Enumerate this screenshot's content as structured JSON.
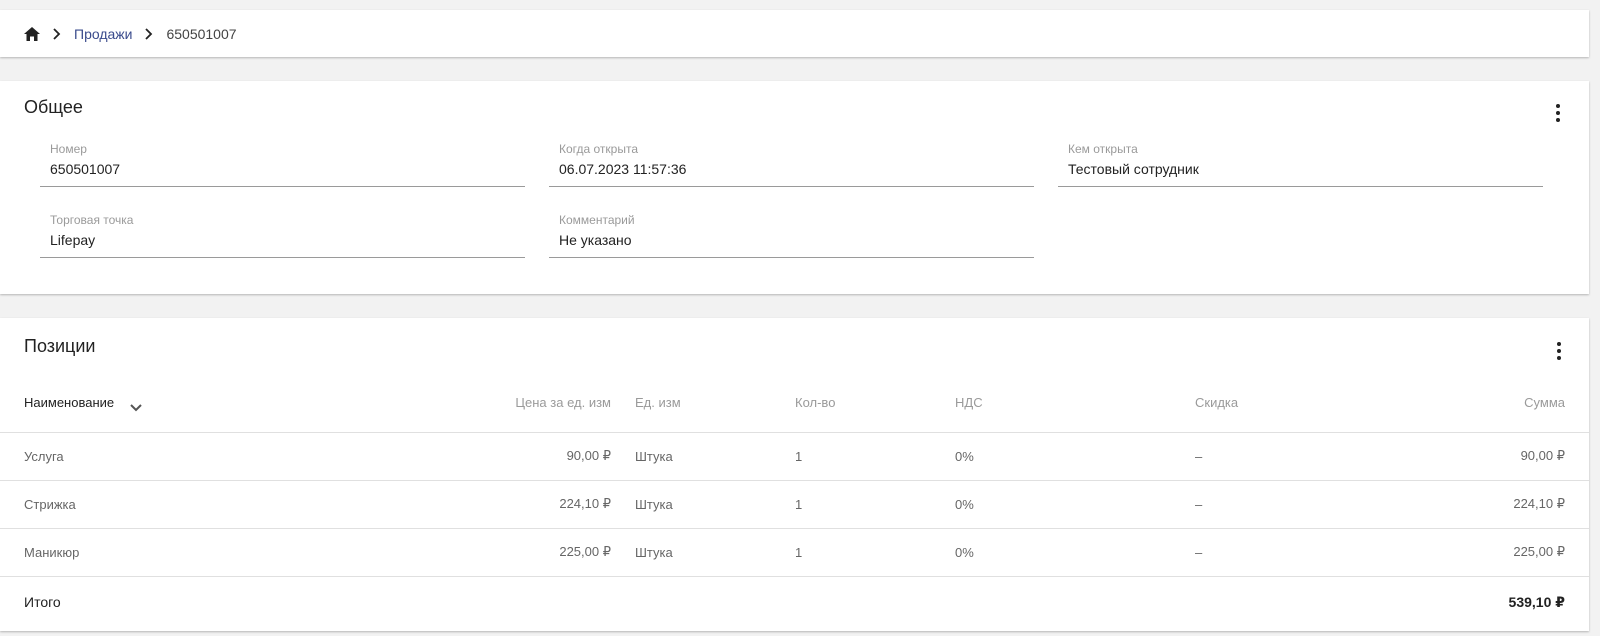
{
  "breadcrumb": {
    "home_icon": "home-icon",
    "items": [
      {
        "label": "Продажи"
      },
      {
        "label": "650501007"
      }
    ]
  },
  "general": {
    "title": "Общее",
    "fields": {
      "number": {
        "label": "Номер",
        "value": "650501007"
      },
      "opened_at": {
        "label": "Когда открыта",
        "value": "06.07.2023 11:57:36"
      },
      "opened_by": {
        "label": "Кем открыта",
        "value": "Тестовый сотрудник"
      },
      "store": {
        "label": "Торговая точка",
        "value": "Lifepay"
      },
      "comment": {
        "label": "Комментарий",
        "value": "Не указано"
      }
    }
  },
  "positions": {
    "title": "Позиции",
    "columns": {
      "name": "Наименование",
      "unit_price": "Цена за ед. изм",
      "unit": "Ед. изм",
      "qty": "Кол-во",
      "vat": "НДС",
      "discount": "Скидка",
      "sum": "Сумма"
    },
    "rows": [
      {
        "name": "Услуга",
        "unit_price": "90,00 ₽",
        "unit": "Штука",
        "qty": "1",
        "vat": "0%",
        "discount": "–",
        "sum": "90,00 ₽"
      },
      {
        "name": "Стрижка",
        "unit_price": "224,10 ₽",
        "unit": "Штука",
        "qty": "1",
        "vat": "0%",
        "discount": "–",
        "sum": "224,10 ₽"
      },
      {
        "name": "Маникюр",
        "unit_price": "225,00 ₽",
        "unit": "Штука",
        "qty": "1",
        "vat": "0%",
        "discount": "–",
        "sum": "225,00 ₽"
      }
    ],
    "total": {
      "label": "Итого",
      "value": "539,10 ₽"
    }
  }
}
